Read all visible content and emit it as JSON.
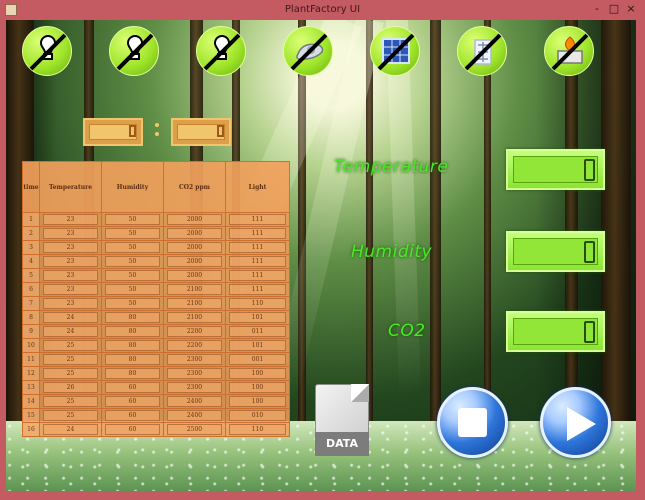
{
  "window": {
    "title": "PlantFactory UI",
    "minimize": "-",
    "maximize": "□",
    "close": "×"
  },
  "toolbar": {
    "buttons": [
      {
        "name": "light-bulb-1",
        "icon": "bulb-icon"
      },
      {
        "name": "light-bulb-2",
        "icon": "bulb-icon"
      },
      {
        "name": "light-bulb-3",
        "icon": "bulb-icon"
      },
      {
        "name": "fan",
        "icon": "fan-icon"
      },
      {
        "name": "solar-panel",
        "icon": "solar-panel-icon"
      },
      {
        "name": "cooling",
        "icon": "snowflake-icon"
      },
      {
        "name": "heater",
        "icon": "heater-icon"
      }
    ]
  },
  "table": {
    "headers": [
      "time",
      "Temperature",
      "Humidity",
      "CO2 ppm",
      "Light"
    ],
    "rows": [
      [
        "1",
        "23",
        "50",
        "2000",
        "111"
      ],
      [
        "2",
        "23",
        "50",
        "2000",
        "111"
      ],
      [
        "3",
        "23",
        "50",
        "2000",
        "111"
      ],
      [
        "4",
        "23",
        "50",
        "2000",
        "111"
      ],
      [
        "5",
        "23",
        "50",
        "2000",
        "111"
      ],
      [
        "6",
        "23",
        "50",
        "2100",
        "111"
      ],
      [
        "7",
        "23",
        "50",
        "2100",
        "110"
      ],
      [
        "8",
        "24",
        "80",
        "2100",
        "101"
      ],
      [
        "9",
        "24",
        "80",
        "2200",
        "011"
      ],
      [
        "10",
        "25",
        "80",
        "2200",
        "101"
      ],
      [
        "11",
        "25",
        "80",
        "2300",
        "001"
      ],
      [
        "12",
        "25",
        "80",
        "2300",
        "100"
      ],
      [
        "13",
        "26",
        "60",
        "2300",
        "100"
      ],
      [
        "14",
        "25",
        "60",
        "2400",
        "100"
      ],
      [
        "15",
        "25",
        "60",
        "2400",
        "010"
      ],
      [
        "16",
        "24",
        "60",
        "2500",
        "110"
      ]
    ]
  },
  "readings": [
    {
      "label": "Temperature"
    },
    {
      "label": "Humidity"
    },
    {
      "label": "CO2"
    }
  ],
  "buttons": {
    "data": "DATA"
  },
  "colors": {
    "accent_green": "#9ee429",
    "table_orange": "#f0a05d",
    "label_green": "#48ea26",
    "play_blue": "#2e75da"
  }
}
